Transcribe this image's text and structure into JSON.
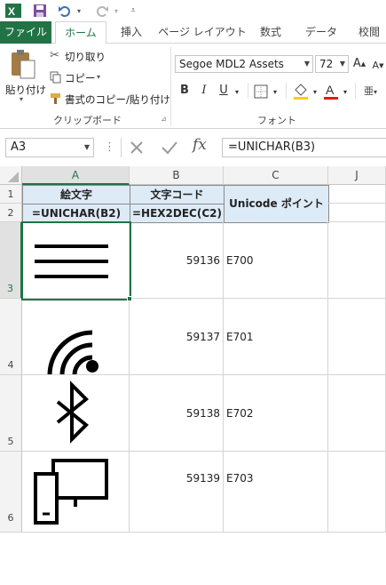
{
  "qat": {
    "app_icon": "excel-icon",
    "save_icon": "save-icon",
    "undo_icon": "undo-icon",
    "redo_icon": "redo-icon",
    "customize_icon": "customize-icon"
  },
  "tabs": [
    "ファイル",
    "ホーム",
    "挿入",
    "ページ レイアウト",
    "数式",
    "データ",
    "校閲"
  ],
  "clipboard": {
    "paste_label": "貼り付け",
    "cut_label": "切り取り",
    "copy_label": "コピー",
    "format_painter_label": "書式のコピー/貼り付け",
    "group_label": "クリップボード"
  },
  "font": {
    "font_name": "Segoe MDL2 Assets",
    "font_size": "72",
    "bold": "B",
    "italic": "I",
    "underline": "U",
    "group_label": "フォント"
  },
  "formula_bar": {
    "name_box": "A3",
    "formula": "=UNICHAR(B3)",
    "fx": "fx"
  },
  "columns": [
    "A",
    "B",
    "C",
    "J"
  ],
  "rows": [
    "1",
    "2",
    "3",
    "4",
    "5",
    "6"
  ],
  "header_row": {
    "a1": "絵文字",
    "b1": "文字コード",
    "c1": "Unicode ポイント",
    "a2": "=UNICHAR(B2)",
    "b2": "=HEX2DEC(C2)"
  },
  "data_rows": [
    {
      "code": "59136",
      "point": "E700",
      "icon": "hamburger-icon"
    },
    {
      "code": "59137",
      "point": "E701",
      "icon": "wifi-icon"
    },
    {
      "code": "59138",
      "point": "E702",
      "icon": "bluetooth-icon"
    },
    {
      "code": "59139",
      "point": "E703",
      "icon": "devices-icon"
    }
  ],
  "colors": {
    "accent": "#217346",
    "header_fill": "#ddebf7"
  }
}
